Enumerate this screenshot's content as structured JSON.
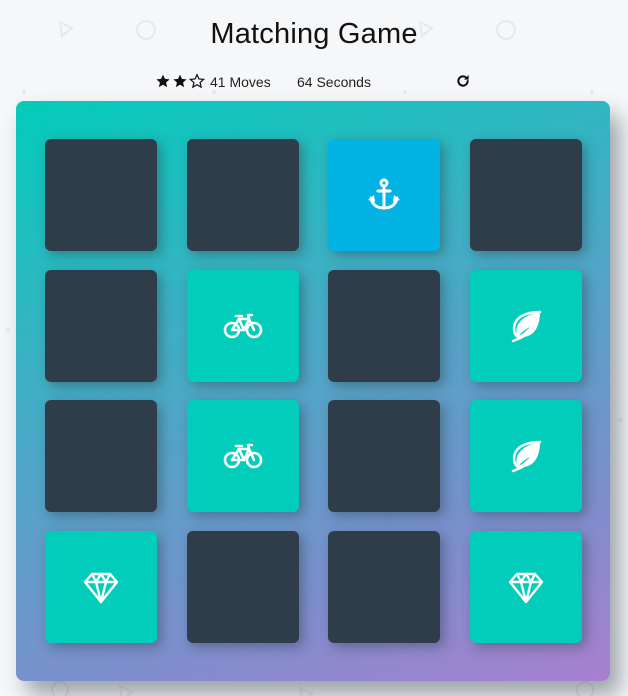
{
  "game": {
    "title": "Matching Game",
    "moves_text": "41 Moves",
    "timer_text": "64 Seconds",
    "rating": {
      "filled": 2,
      "total": 3
    },
    "restart_icon": "refresh-icon"
  },
  "colors": {
    "card_back": "#2e3d49",
    "card_open": "#02b3e4",
    "card_match": "#02ccba",
    "deck_gradient_start": "#02ccba",
    "deck_gradient_end": "#a97fd0"
  },
  "cards": [
    {
      "state": "hidden",
      "icon": ""
    },
    {
      "state": "hidden",
      "icon": ""
    },
    {
      "state": "open",
      "icon": "anchor-icon"
    },
    {
      "state": "hidden",
      "icon": ""
    },
    {
      "state": "hidden",
      "icon": ""
    },
    {
      "state": "match",
      "icon": "bicycle-icon"
    },
    {
      "state": "hidden",
      "icon": ""
    },
    {
      "state": "match",
      "icon": "leaf-icon"
    },
    {
      "state": "hidden",
      "icon": ""
    },
    {
      "state": "match",
      "icon": "bicycle-icon"
    },
    {
      "state": "hidden",
      "icon": ""
    },
    {
      "state": "match",
      "icon": "leaf-icon"
    },
    {
      "state": "match",
      "icon": "diamond-icon"
    },
    {
      "state": "hidden",
      "icon": ""
    },
    {
      "state": "hidden",
      "icon": ""
    },
    {
      "state": "match",
      "icon": "diamond-icon"
    }
  ]
}
